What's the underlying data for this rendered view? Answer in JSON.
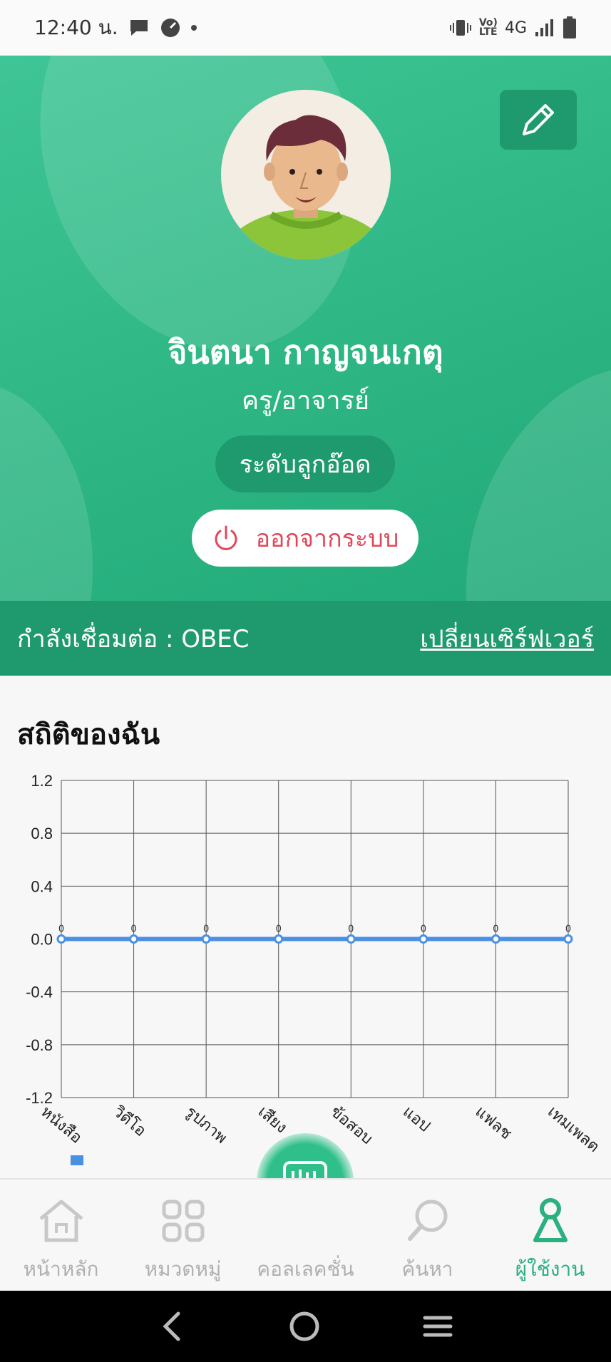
{
  "status": {
    "time": "12:40 น.",
    "network": "4G"
  },
  "profile": {
    "name": "จินตนา กาญจนเกตุ",
    "role": "ครู/อาจารย์",
    "level": "ระดับลูกอ๊อด",
    "logout_label": "ออกจากระบบ"
  },
  "server": {
    "label": "กำลังเชื่อมต่อ : OBEC",
    "change_label": "เปลี่ยนเซิร์ฟเวอร์"
  },
  "stats": {
    "title": "สถิติของฉัน"
  },
  "chart_data": {
    "type": "line",
    "categories": [
      "หนังสือ",
      "วิดีโอ",
      "รูปภาพ",
      "เสียง",
      "ข้อสอบ",
      "แอป",
      "แฟลช",
      "เทมเพลต"
    ],
    "values": [
      0,
      0,
      0,
      0,
      0,
      0,
      0,
      0
    ],
    "data_labels": [
      "0",
      "0",
      "0",
      "0",
      "0",
      "0",
      "0",
      "0"
    ],
    "yticks": [
      "1.2",
      "0.8",
      "0.4",
      "0.0",
      "-0.4",
      "-0.8",
      "-1.2"
    ],
    "ylim": [
      -1.2,
      1.2
    ],
    "grid": true,
    "series_color": "#4a90e2"
  },
  "tabs": [
    {
      "label": "หน้าหลัก",
      "icon": "home-icon"
    },
    {
      "label": "หมวดหมู่",
      "icon": "category-icon"
    },
    {
      "label": "คอลเลคชั่น",
      "icon": "collection-icon"
    },
    {
      "label": "ค้นหา",
      "icon": "search-icon"
    },
    {
      "label": "ผู้ใช้งาน",
      "icon": "user-icon",
      "active": true
    }
  ],
  "colors": {
    "accent": "#2bb07f",
    "header": "#2fb885",
    "logout": "#e0485a"
  }
}
